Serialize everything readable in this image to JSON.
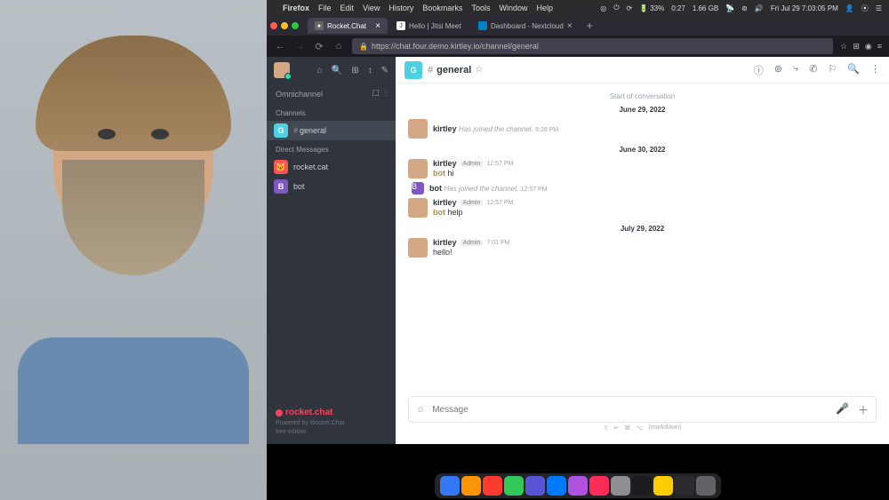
{
  "menubar": {
    "app_name": "Firefox",
    "menus": [
      "File",
      "Edit",
      "View",
      "History",
      "Bookmarks",
      "Tools",
      "Window",
      "Help"
    ],
    "battery": "33%",
    "time_short": "0:27",
    "memory": "1.66 GB",
    "datetime": "Fri Jul 29  7:03:05 PM"
  },
  "tabs": [
    {
      "title": "Rocket.Chat",
      "active": true
    },
    {
      "title": "Hello | Jitsi Meet",
      "active": false
    },
    {
      "title": "Dashboard - Nextcloud",
      "active": false
    }
  ],
  "url": "https://chat.four.demo.kirtley.io/channel/general",
  "sidebar": {
    "omni": "Omnichannel",
    "sections": {
      "channels": {
        "label": "Channels",
        "items": [
          {
            "avatar": "G",
            "name": "general",
            "hash": true,
            "active": true
          }
        ]
      },
      "dm": {
        "label": "Direct Messages",
        "items": [
          {
            "avatar": "🐱",
            "name": "rocket.cat",
            "cls": "chan-cat"
          },
          {
            "avatar": "B",
            "name": "bot",
            "cls": "chan-B"
          }
        ]
      }
    },
    "brand": "rocket.chat",
    "powered": "Powered by Rocket.Chat",
    "edition": "free edition"
  },
  "channel": {
    "avatar": "G",
    "name": "general",
    "start": "Start of conversation",
    "dates": {
      "d1": "June 29, 2022",
      "d2": "June 30, 2022",
      "d3": "July 29, 2022"
    }
  },
  "messages": {
    "m1": {
      "user": "kirtley",
      "system": "Has joined the channel.",
      "time": "6:28 PM"
    },
    "m2": {
      "user": "kirtley",
      "badge": "Admin",
      "time": "12:57 PM",
      "mention": "bot",
      "text": "hi"
    },
    "m3": {
      "user": "bot",
      "system": "Has joined the channel.",
      "time": "12:57 PM"
    },
    "m4": {
      "user": "kirtley",
      "badge": "Admin",
      "time": "12:57 PM",
      "mention": "bot",
      "text": "help"
    },
    "m5": {
      "user": "kirtley",
      "badge": "Admin",
      "time": "7:01 PM",
      "text": "hello!"
    }
  },
  "composer": {
    "placeholder": "Message"
  }
}
